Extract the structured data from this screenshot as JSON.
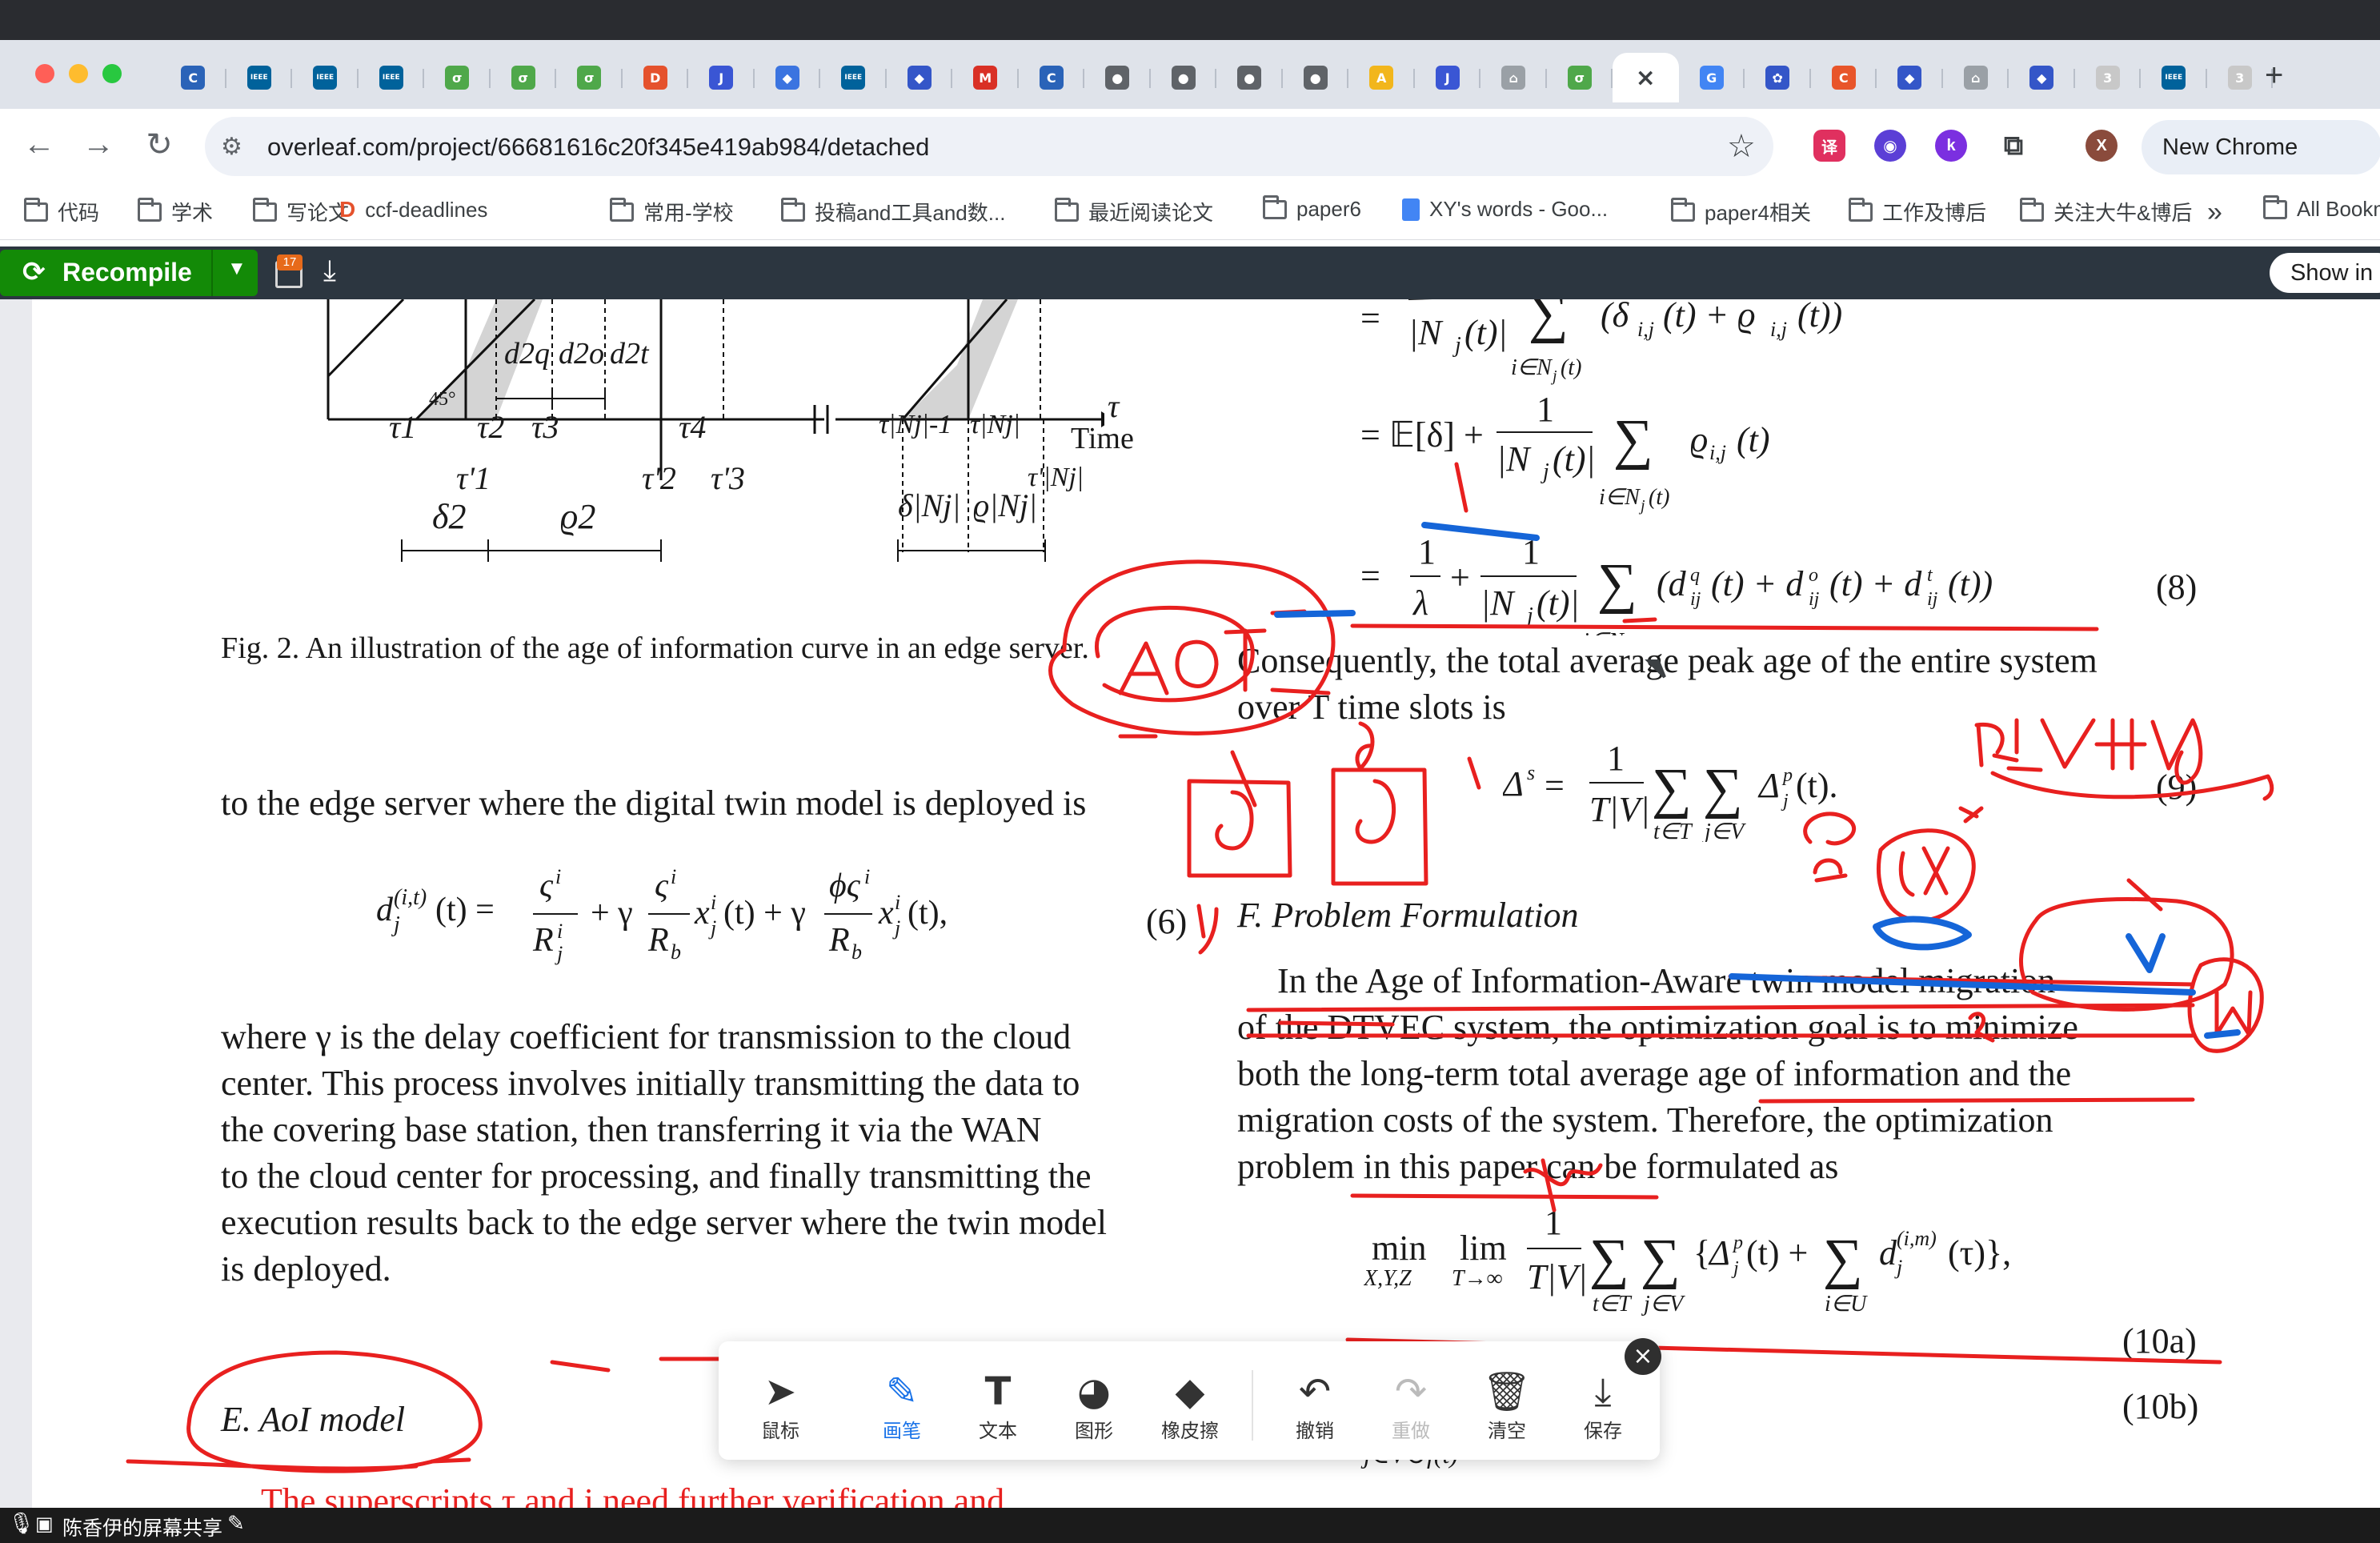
{
  "browser": {
    "url": "overleaf.com/project/66681616c20f345e419ab984/detached",
    "new_chrome_label": "New Chrome",
    "tabs": [
      {
        "icon": "C",
        "color": "#2a63b8"
      },
      {
        "icon": "IEEE",
        "color": "#00629b"
      },
      {
        "icon": "IEEE",
        "color": "#00629b"
      },
      {
        "icon": "IEEE",
        "color": "#00629b"
      },
      {
        "icon": "σ",
        "color": "#4fa84a"
      },
      {
        "icon": "σ",
        "color": "#4fa84a"
      },
      {
        "icon": "σ",
        "color": "#4fa84a"
      },
      {
        "icon": "D",
        "color": "#e5522d"
      },
      {
        "icon": "J",
        "color": "#3a56d4"
      },
      {
        "icon": "◆",
        "color": "#3b74e0"
      },
      {
        "icon": "IEEE",
        "color": "#00629b"
      },
      {
        "icon": "◆",
        "color": "#3456c8"
      },
      {
        "icon": "M",
        "color": "#d93025"
      },
      {
        "icon": "C",
        "color": "#2a63b8"
      },
      {
        "icon": "●",
        "color": "#5f6368"
      },
      {
        "icon": "●",
        "color": "#5f6368"
      },
      {
        "icon": "●",
        "color": "#5f6368"
      },
      {
        "icon": "●",
        "color": "#5f6368"
      },
      {
        "icon": "A",
        "color": "#f2b61c"
      },
      {
        "icon": "J",
        "color": "#3a56d4"
      },
      {
        "icon": "⌂",
        "color": "#9aa0a6"
      },
      {
        "icon": "σ",
        "color": "#4fa84a"
      },
      {
        "icon": "×",
        "color": "#ffffff",
        "active": true
      },
      {
        "icon": "G",
        "color": "#4285f4"
      },
      {
        "icon": "✿",
        "color": "#3456c8"
      },
      {
        "icon": "C",
        "color": "#e8552a"
      },
      {
        "icon": "◆",
        "color": "#3456c8"
      },
      {
        "icon": "⌂",
        "color": "#9aa0a6"
      },
      {
        "icon": "◆",
        "color": "#3456c8"
      },
      {
        "icon": "3",
        "color": "#c8c8c8"
      },
      {
        "icon": "IEEE",
        "color": "#00629b"
      },
      {
        "icon": "3",
        "color": "#c8c8c8"
      }
    ],
    "new_tab": "+",
    "bookmarks": [
      {
        "label": "代码",
        "type": "folder"
      },
      {
        "label": "学术",
        "type": "folder"
      },
      {
        "label": "写论文",
        "type": "folder"
      },
      {
        "label": "ccf-deadlines",
        "type": "site"
      },
      {
        "label": "常用-学校",
        "type": "folder"
      },
      {
        "label": "投稿and工具and数...",
        "type": "folder"
      },
      {
        "label": "最近阅读论文",
        "type": "folder"
      },
      {
        "label": "paper6",
        "type": "folder"
      },
      {
        "label": "XY's words - Goo...",
        "type": "doc"
      },
      {
        "label": "paper4相关",
        "type": "folder"
      },
      {
        "label": "工作及博后",
        "type": "folder"
      },
      {
        "label": "关注大牛&博后",
        "type": "folder"
      },
      {
        "label": "»",
        "type": "more"
      },
      {
        "label": "All Bookm",
        "type": "folder"
      }
    ]
  },
  "overleaf": {
    "recompile_label": "Recompile",
    "show_in_label": "Show in",
    "badge": "17"
  },
  "paper": {
    "figure": {
      "tau_labels": [
        "τ1",
        "τ2",
        "τ3",
        "τ4",
        "τ|Nj|-1",
        "τ|Nj|",
        "τ"
      ],
      "tau_prime": [
        "τ'1",
        "τ'2",
        "τ'3",
        "τ'|Nj|"
      ],
      "delta_labels": [
        "d2q",
        "d2o",
        "d2t"
      ],
      "bottom_labels": [
        "δ2",
        "ϱ2",
        "δ|Nj|",
        "ϱ|Nj|"
      ],
      "angle": "45°",
      "axis_label": "Time"
    },
    "fig_caption": "Fig. 2.  An illustration of the age of information curve in an edge server.",
    "left_col": {
      "line_edge": "to the edge server where the digital twin model is deployed is",
      "eq6_lhs": "d",
      "eq6_label": "(6)",
      "para": [
        "where γ is the delay coefficient for transmission to the cloud",
        "center. This process involves initially transmitting the data to",
        "the covering base station, then transferring it via the WAN",
        "to the cloud center for processing, and finally transmitting the",
        "execution results back to the edge server where the twin model",
        "is deployed."
      ],
      "section_e": "E.  AoI model",
      "cut_line": "The superscripts τ and i need further verification and"
    },
    "right_col": {
      "eq8_label": "(8)",
      "consequently": [
        "Consequently, the total average peak age of the entire system",
        "over T time slots is"
      ],
      "eq9_label": "(9)",
      "section_f": "F.  Problem Formulation",
      "para": [
        "In the Age of Information-Aware twin model migration",
        "of the DTVEC system, the optimization goal is to minimize",
        "both the long-term total average age of information and the",
        "migration costs of the system. Therefore, the optimization",
        "problem in this paper can be formulated as"
      ],
      "eq10a_label": "(10a)",
      "eq10b_label": "(10b)"
    }
  },
  "annotation_toolbar": {
    "tools": [
      {
        "label": "鼠标",
        "icon": "cursor-icon"
      },
      {
        "label": "画笔",
        "icon": "pen-icon",
        "active": true
      },
      {
        "label": "文本",
        "icon": "text-icon"
      },
      {
        "label": "图形",
        "icon": "shape-icon"
      },
      {
        "label": "橡皮擦",
        "icon": "eraser-icon"
      },
      {
        "label": "撤销",
        "icon": "undo-icon"
      },
      {
        "label": "重做",
        "icon": "redo-icon"
      },
      {
        "label": "清空",
        "icon": "trash-icon"
      },
      {
        "label": "保存",
        "icon": "save-icon"
      }
    ]
  },
  "share_bar": {
    "label": "陈香伊的屏幕共享"
  },
  "colors": {
    "ink_red": "#e8201f",
    "ink_blue": "#1565d8",
    "overleaf_green": "#138a07",
    "overleaf_bar": "#2c3640"
  }
}
